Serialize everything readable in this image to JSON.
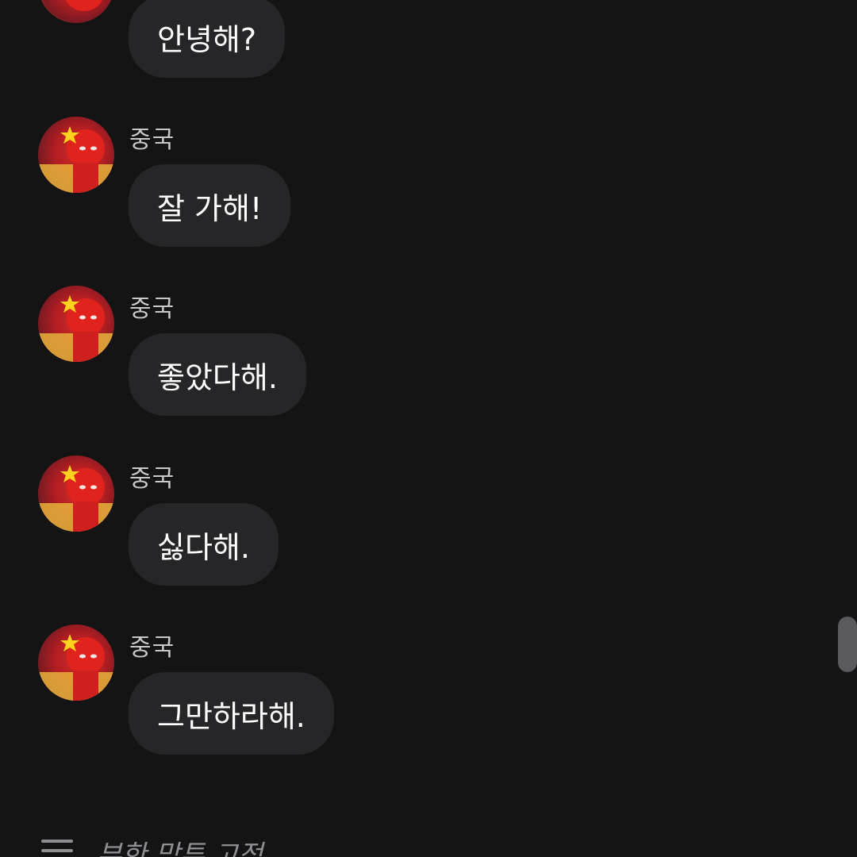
{
  "chat": {
    "first_message": "안녕해?",
    "messages": [
      {
        "sender": "중국",
        "text": "잘 가해!"
      },
      {
        "sender": "중국",
        "text": "좋았다해."
      },
      {
        "sender": "중국",
        "text": "싫다해."
      },
      {
        "sender": "중국",
        "text": "그만하라해."
      }
    ]
  },
  "bottom_bar": {
    "label": "부한 맏투 고정"
  },
  "colors": {
    "background": "#141415",
    "bubble": "#262628",
    "sender_text": "#c9c9cc"
  },
  "icons": [
    "avatar-icon",
    "menu-icon"
  ]
}
